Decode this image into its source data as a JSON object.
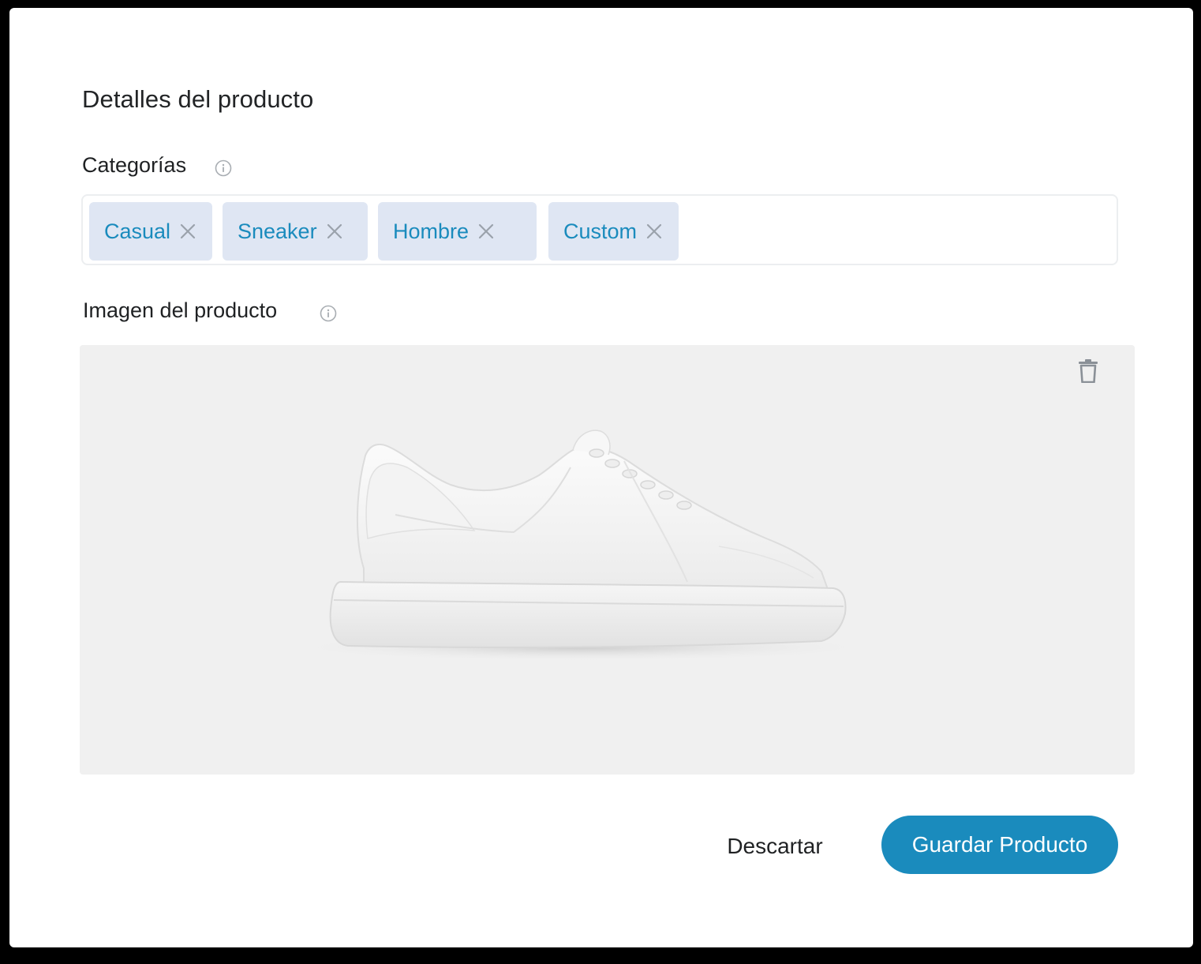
{
  "dialog": {
    "title": "Detalles del producto"
  },
  "categories": {
    "label": "Categorías",
    "chips": [
      {
        "label": "Casual"
      },
      {
        "label": "Sneaker"
      },
      {
        "label": "Hombre"
      },
      {
        "label": "Custom"
      }
    ]
  },
  "product_image": {
    "label": "Imagen del producto"
  },
  "actions": {
    "discard_label": "Descartar",
    "save_label": "Guardar Producto"
  },
  "colors": {
    "accent": "#1a8bbd",
    "chip_background": "#dfe6f3",
    "image_background": "#f0f0f0"
  },
  "icons": {
    "info": "info-icon",
    "remove": "close-icon",
    "delete": "trash-icon"
  }
}
